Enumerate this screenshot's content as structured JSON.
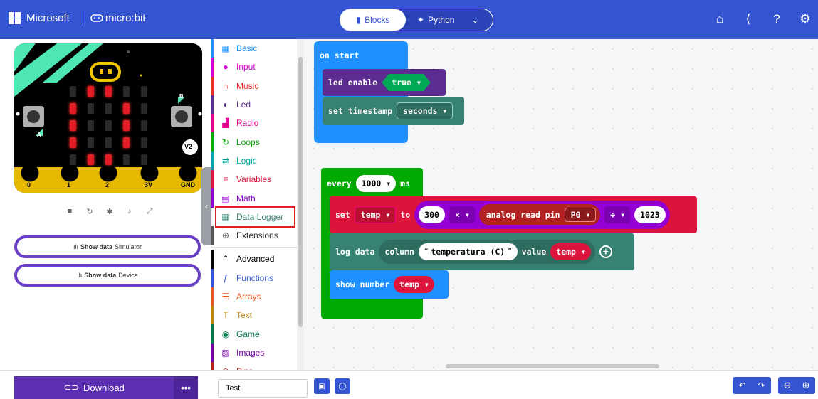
{
  "header": {
    "brand": "Microsoft",
    "product": "micro:bit",
    "mode_blocks": "Blocks",
    "mode_python": "Python"
  },
  "simulator": {
    "version_badge": "V2",
    "button_a": "A",
    "button_b": "B",
    "pins": [
      "0",
      "1",
      "2",
      "3V",
      "GND"
    ],
    "show_data_simulator": {
      "prefix": "Show data",
      "target": "Simulator"
    },
    "show_data_device": {
      "prefix": "Show data",
      "target": "Device"
    }
  },
  "toolbox": {
    "items": [
      {
        "label": "Basic",
        "color": "#1E90FF",
        "icon": "grid-icon"
      },
      {
        "label": "Input",
        "color": "#D400D4",
        "icon": "circle-icon"
      },
      {
        "label": "Music",
        "color": "#E63022",
        "icon": "headphones-icon"
      },
      {
        "label": "Led",
        "color": "#5C2D91",
        "icon": "toggle-icon"
      },
      {
        "label": "Radio",
        "color": "#E3008C",
        "icon": "signal-icon"
      },
      {
        "label": "Loops",
        "color": "#00AA00",
        "icon": "loop-icon"
      },
      {
        "label": "Logic",
        "color": "#00A4A6",
        "icon": "shuffle-icon"
      },
      {
        "label": "Variables",
        "color": "#DC143C",
        "icon": "lines-icon"
      },
      {
        "label": "Math",
        "color": "#9400D3",
        "icon": "calculator-icon"
      },
      {
        "label": "Data Logger",
        "color": "#378273",
        "icon": "table-icon"
      },
      {
        "label": "Extensions",
        "color": "#555555",
        "icon": "plus-icon"
      }
    ],
    "advanced": [
      {
        "label": "Advanced",
        "color": "#000000",
        "icon": "chevron-up-icon"
      },
      {
        "label": "Functions",
        "color": "#3455DB",
        "icon": "function-icon"
      },
      {
        "label": "Arrays",
        "color": "#E65722",
        "icon": "list-icon"
      },
      {
        "label": "Text",
        "color": "#B8860B",
        "icon": "text-icon"
      },
      {
        "label": "Game",
        "color": "#007A4B",
        "icon": "gamepad-icon"
      },
      {
        "label": "Images",
        "color": "#7600A8",
        "icon": "image-icon"
      },
      {
        "label": "Pins",
        "color": "#B22222",
        "icon": "pin-icon"
      }
    ]
  },
  "blocks": {
    "on_start": "on start",
    "led_enable": "led enable",
    "led_enable_value": "true",
    "set_timestamp": "set timestamp",
    "set_timestamp_value": "seconds",
    "every": "every",
    "every_value": "1000",
    "every_unit": "ms",
    "set": "set",
    "set_var": "temp",
    "to": "to",
    "num_300": "300",
    "op_mul": "×",
    "analog_read": "analog read pin",
    "pin": "P0",
    "op_div": "÷",
    "num_1023": "1023",
    "log_data": "log data",
    "column": "column",
    "column_value": "temperatura (C)",
    "value": "value",
    "value_var": "temp",
    "show_number": "show number",
    "show_var": "temp"
  },
  "footer": {
    "download": "Download",
    "more": "•••",
    "project_name": "Test"
  },
  "colors": {
    "header": "#3454D1",
    "basic": "#1E90FF",
    "led": "#5C2D91",
    "datalogger": "#378273",
    "loops": "#00AA00",
    "variables": "#DC143C",
    "math": "#9400D3",
    "pins": "#B22222"
  }
}
